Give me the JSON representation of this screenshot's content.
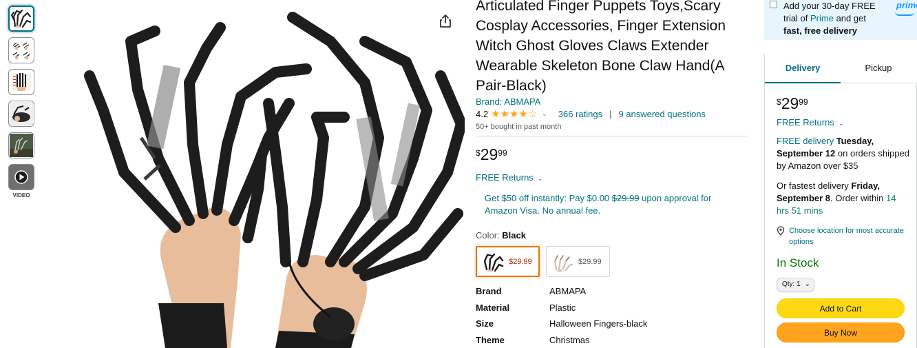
{
  "thumbnails": {
    "video_label": "VIDEO"
  },
  "product": {
    "title": "Articulated Finger Puppets Toys,Scary Cosplay Accessories, Finger Extension Witch Ghost Gloves Claws Extender Wearable Skeleton Bone Claw Hand(A Pair-Black)",
    "brand_link": "Brand: ABMAPA",
    "rating_value": "4.2",
    "rating_stars": 4.2,
    "ratings_count": "366 ratings",
    "rating_separator": "|",
    "answered_questions": "9 answered questions",
    "bought_text": "50+ bought in past month",
    "price": {
      "symbol": "$",
      "whole": "29",
      "fraction": "99"
    },
    "free_returns": "FREE Returns",
    "promo": {
      "prefix": "Get $50 off instantly: Pay $0.00 ",
      "struck": "$29.99",
      "suffix": " upon approval for Amazon Visa. No annual fee."
    },
    "color_label": "Color: ",
    "color_value": "Black",
    "swatches": [
      {
        "price": "$29.99"
      },
      {
        "price": "$29.99"
      }
    ],
    "specs": [
      {
        "key": "Brand",
        "value": "ABMAPA"
      },
      {
        "key": "Material",
        "value": "Plastic"
      },
      {
        "key": "Size",
        "value": "Halloween Fingers-black"
      },
      {
        "key": "Theme",
        "value": "Christmas"
      }
    ]
  },
  "buybox": {
    "prime_banner": {
      "line_prefix": "Add your 30-day FREE trial of ",
      "prime_link": "Prime",
      "line_mid": " and get ",
      "bold": "fast, free delivery",
      "logo": "prime"
    },
    "tabs": [
      "Delivery",
      "Pickup"
    ],
    "price": {
      "symbol": "$",
      "whole": "29",
      "fraction": "99"
    },
    "free_returns": "FREE Returns",
    "delivery": {
      "link": "FREE delivery",
      "date": "Tuesday, September 12",
      "suffix": " on orders shipped by Amazon over $35"
    },
    "fastest": {
      "prefix": "Or fastest delivery ",
      "date": "Friday, September 8",
      "mid": ". Order within ",
      "countdown": "14 hrs 51 mins"
    },
    "location": "Choose location for most accurate options",
    "stock": "In Stock",
    "qty": "Qty: 1",
    "add_to_cart": "Add to Cart",
    "buy_now": "Buy Now"
  },
  "colors": {
    "link": "#007185",
    "price_red": "#b12704",
    "in_stock": "#007600",
    "cart_yellow": "#ffd814",
    "buy_orange": "#ffa41c",
    "prime_blue": "#1a98ff",
    "prime_bg": "#e7f6fd"
  },
  "icons": [
    "share-icon",
    "chevron-down-icon",
    "location-pin-icon",
    "play-icon",
    "star-icon"
  ]
}
